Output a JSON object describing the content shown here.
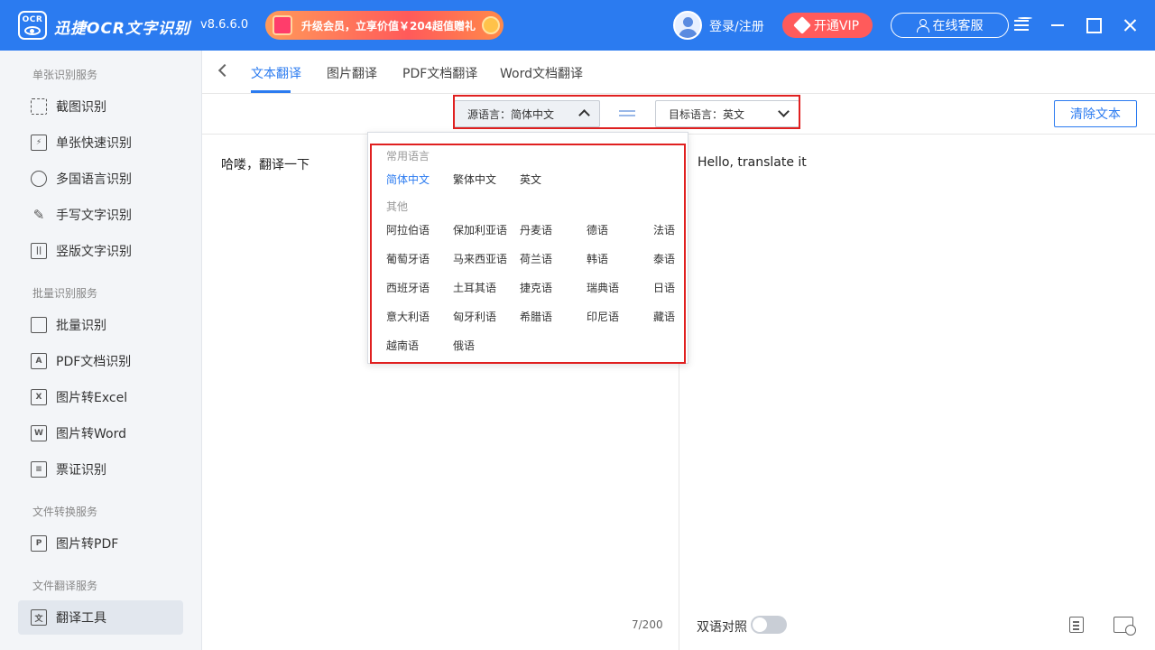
{
  "app": {
    "logo_text": "OCR",
    "title": "迅捷OCR文字识别",
    "version": "v8.6.6.0",
    "promo": "升级会员，立享价值￥204超值赠礼",
    "login": "登录/注册",
    "vip": "开通VIP",
    "service": "在线客服"
  },
  "sidebar": {
    "sections": [
      "单张识别服务",
      "批量识别服务",
      "文件转换服务",
      "文件翻译服务"
    ],
    "items": [
      {
        "label": "截图识别",
        "icon": "crop-icon"
      },
      {
        "label": "单张快速识别",
        "icon": "quick-scan-icon"
      },
      {
        "label": "多国语言识别",
        "icon": "globe-icon"
      },
      {
        "label": "手写文字识别",
        "icon": "pen-icon"
      },
      {
        "label": "竖版文字识别",
        "icon": "vertical-text-icon"
      },
      {
        "label": "批量识别",
        "icon": "batch-icon"
      },
      {
        "label": "PDF文档识别",
        "icon": "pdf-icon"
      },
      {
        "label": "图片转Excel",
        "icon": "excel-icon"
      },
      {
        "label": "图片转Word",
        "icon": "word-icon"
      },
      {
        "label": "票证识别",
        "icon": "ticket-icon"
      },
      {
        "label": "图片转PDF",
        "icon": "image-to-pdf-icon"
      },
      {
        "label": "翻译工具",
        "icon": "translate-icon"
      }
    ]
  },
  "tabs": [
    "文本翻译",
    "图片翻译",
    "PDF文档翻译",
    "Word文档翻译"
  ],
  "lang": {
    "source": "源语言：简体中文",
    "target": "目标语言：英文",
    "clear": "清除文本"
  },
  "editor": {
    "source_text": "哈喽，翻译一下",
    "target_text": "Hello, translate it",
    "char_count": "7/200",
    "bilingual": "双语对照"
  },
  "dropdown": {
    "common_header": "常用语言",
    "common": [
      "简体中文",
      "繁体中文",
      "英文"
    ],
    "other_header": "其他",
    "others": [
      "阿拉伯语",
      "保加利亚语",
      "丹麦语",
      "德语",
      "法语",
      "葡萄牙语",
      "马来西亚语",
      "荷兰语",
      "韩语",
      "泰语",
      "西班牙语",
      "土耳其语",
      "捷克语",
      "瑞典语",
      "日语",
      "意大利语",
      "匈牙利语",
      "希腊语",
      "印尼语",
      "藏语",
      "越南语",
      "俄语"
    ]
  },
  "colors": {
    "brand": "#2b7bf0",
    "highlight_outline": "#e02020",
    "vip": "#ff5b5b"
  }
}
